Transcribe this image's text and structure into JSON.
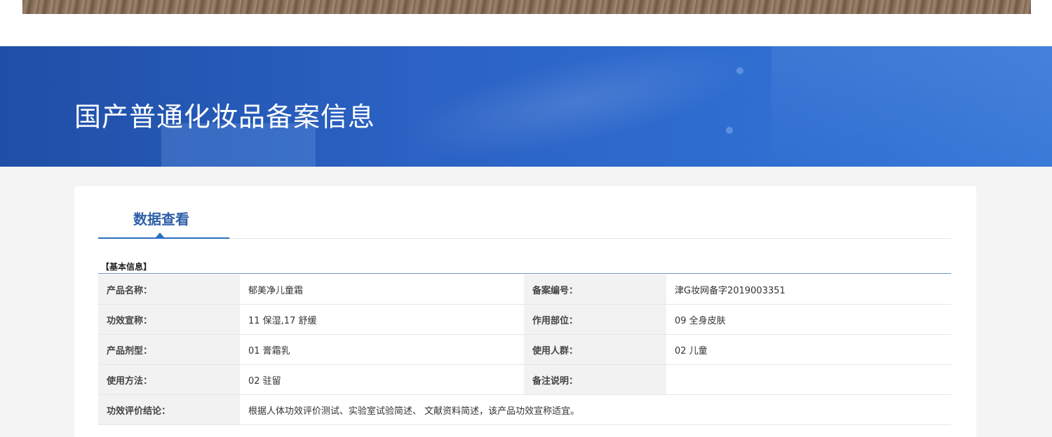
{
  "hero": {
    "title": "国产普通化妆品备案信息"
  },
  "tab": {
    "label": "数据查看"
  },
  "section": {
    "title": "【基本信息】"
  },
  "rows": [
    {
      "label1": "产品名称：",
      "value1": "郁美净儿童霜",
      "label2": "备案编号：",
      "value2": "津G妆网备字2019003351"
    },
    {
      "label1": "功效宣称：",
      "value1": "11 保湿,17 舒缓",
      "label2": "作用部位：",
      "value2": "09 全身皮肤"
    },
    {
      "label1": "产品剂型：",
      "value1": "01 膏霜乳",
      "label2": "使用人群：",
      "value2": "02 儿童"
    },
    {
      "label1": "使用方法：",
      "value1": "02 驻留",
      "label2": "备注说明：",
      "value2": ""
    }
  ],
  "conclusion": {
    "label": "功效评价结论：",
    "value": "根据人体功效评价测试、实验室试验简述、 文献资料简述，该产品功效宣称适宜。"
  },
  "colors": {
    "hero_blue": "#2b62c4",
    "tab_accent": "#2e6fc0",
    "label_bg": "#f2f2f2"
  }
}
